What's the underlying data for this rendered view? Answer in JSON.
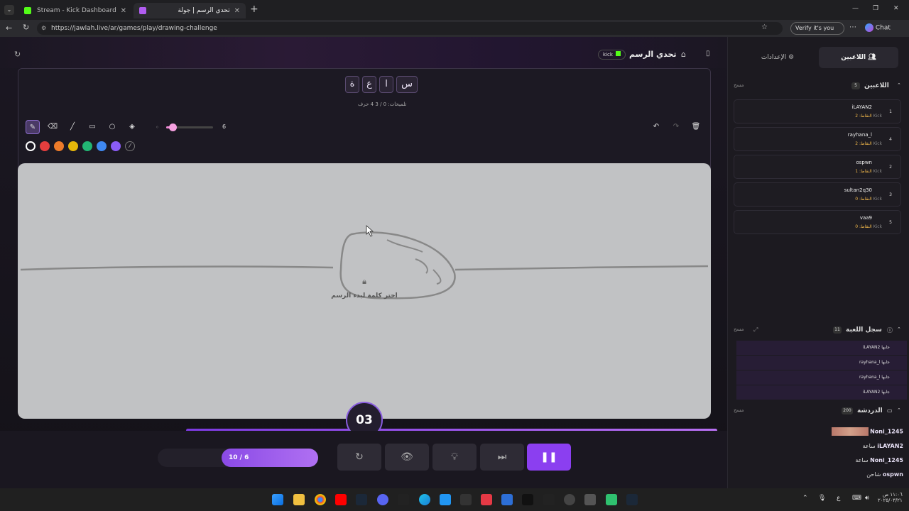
{
  "browser": {
    "tabs": [
      {
        "title": "Stream - Kick Dashboard",
        "close": "✕"
      },
      {
        "title": "تحدي الرسم | جولة",
        "close": "✕"
      }
    ],
    "new_tab": "+",
    "url": "https://jawlah.live/ar/games/play/drawing-challenge",
    "verify_label": "Verify it's you",
    "chat_label": "Chat",
    "window_controls": [
      "—",
      "❐",
      "✕"
    ]
  },
  "topbar": {
    "title": "تحدي الرسم",
    "kick_badge": "kick"
  },
  "word": {
    "letters": [
      "ة",
      "ع",
      "ا",
      "س"
    ],
    "letter_count": "4 حرف",
    "hints": "تلميحات: 0 / 3"
  },
  "toolbar": {
    "brush_size": "6",
    "colors": [
      "#1c1923",
      "#e53e3e",
      "#ed7b2a",
      "#e5b60a",
      "#22b573",
      "#3f88f0",
      "#8b5cf6"
    ]
  },
  "canvas": {
    "prompt": "اختر كلمة لبدء الرسم"
  },
  "timer": "03",
  "round": "10 / 6",
  "progress": 0.69,
  "sidebar": {
    "tab_players": "اللاعبين",
    "tab_settings": "الإعدادات",
    "players_title": "اللاعبين",
    "players_count": "5",
    "clear_label": "مسح",
    "players": [
      {
        "name": "iLAYAN2",
        "platform": "Kick",
        "points": "النقاط: 2",
        "rank": "1"
      },
      {
        "name": "rayhana_l",
        "platform": "Kick",
        "points": "النقاط: 2",
        "rank": "4"
      },
      {
        "name": "ospwn",
        "platform": "Kick",
        "points": "النقاط: 1",
        "rank": "2"
      },
      {
        "name": "sultan2q30",
        "platform": "Kick",
        "points": "النقاط: 0",
        "rank": "3"
      },
      {
        "name": "vaa9",
        "platform": "Kick",
        "points": "النقاط: 0",
        "rank": "5"
      }
    ],
    "log_title": "سجل اللعبة",
    "log_count": "11",
    "log": [
      "iLAYAN2 جابها",
      "rayhana_l جابها",
      "rayhana_l جابها",
      "iLAYAN2 جابها"
    ],
    "chat_title": "الدردشة",
    "chat_count": "200",
    "chat": [
      {
        "user": "Noni_1245",
        "text": ""
      },
      {
        "user": "iLAYAN2",
        "text": "ساعة"
      },
      {
        "user": "Noni_1245",
        "text": "ساعة"
      },
      {
        "user": "ospwn",
        "text": "شاحن"
      }
    ]
  },
  "taskbar": {
    "clock_time": "١١:٠٦ ص",
    "clock_date": "٢٠٢٥/٠٣/٢١",
    "lang": "ع"
  }
}
